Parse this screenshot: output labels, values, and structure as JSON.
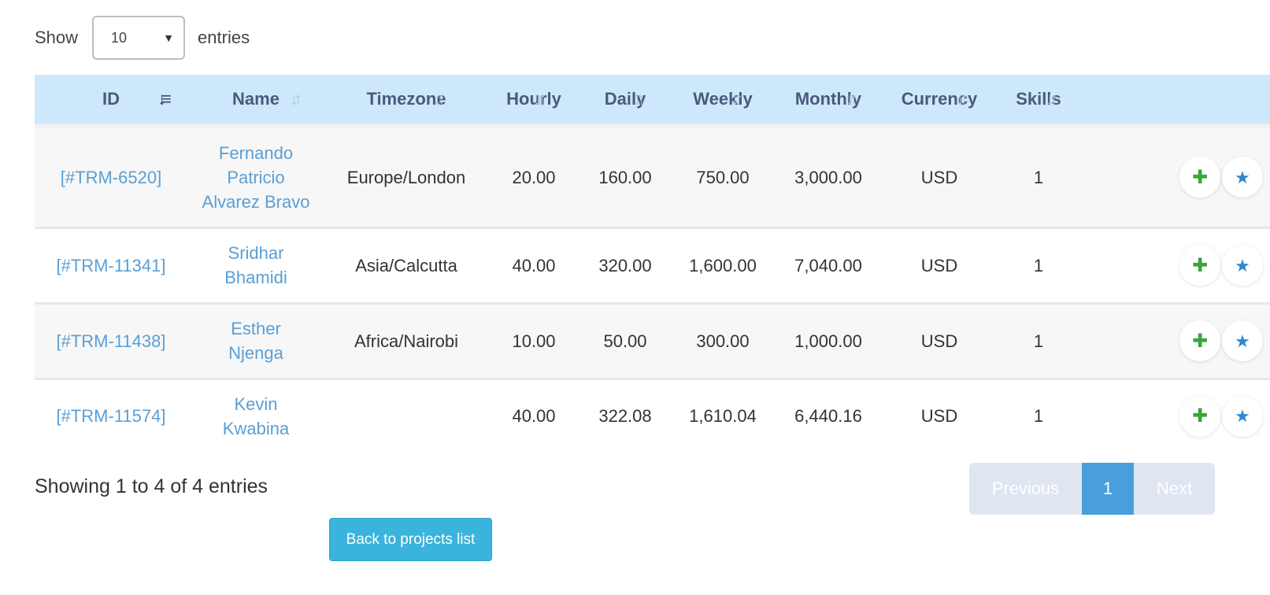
{
  "length": {
    "show_label": "Show",
    "value": "10",
    "entries_label": "entries"
  },
  "table": {
    "columns": [
      {
        "label": "ID",
        "sort": "desc"
      },
      {
        "label": "Name",
        "sort": "both"
      },
      {
        "label": "Timezone",
        "sort": "both"
      },
      {
        "label": "Hourly",
        "sort": "both"
      },
      {
        "label": "Daily",
        "sort": "both"
      },
      {
        "label": "Weekly",
        "sort": "both"
      },
      {
        "label": "Monthly",
        "sort": "both"
      },
      {
        "label": "Currency",
        "sort": "both"
      },
      {
        "label": "Skills",
        "sort": "both"
      }
    ],
    "rows": [
      {
        "id": "[#TRM-6520]",
        "name": "Fernando Patricio Alvarez Bravo",
        "timezone": "Europe/London",
        "hourly": "20.00",
        "daily": "160.00",
        "weekly": "750.00",
        "monthly": "3,000.00",
        "currency": "USD",
        "skills": "1"
      },
      {
        "id": "[#TRM-11341]",
        "name": "Sridhar Bhamidi",
        "timezone": "Asia/Calcutta",
        "hourly": "40.00",
        "daily": "320.00",
        "weekly": "1,600.00",
        "monthly": "7,040.00",
        "currency": "USD",
        "skills": "1"
      },
      {
        "id": "[#TRM-11438]",
        "name": "Esther Njenga",
        "timezone": "Africa/Nairobi",
        "hourly": "10.00",
        "daily": "50.00",
        "weekly": "300.00",
        "monthly": "1,000.00",
        "currency": "USD",
        "skills": "1"
      },
      {
        "id": "[#TRM-11574]",
        "name": "Kevin Kwabina",
        "timezone": "",
        "hourly": "40.00",
        "daily": "322.08",
        "weekly": "1,610.04",
        "monthly": "6,440.16",
        "currency": "USD",
        "skills": "1"
      }
    ],
    "actions": {
      "add_icon": "plus-icon",
      "favorite_icon": "star-icon"
    }
  },
  "info": "Showing 1 to 4 of 4 entries",
  "pagination": {
    "previous": "Previous",
    "current": "1",
    "next": "Next"
  },
  "back_button": "Back to projects list",
  "colors": {
    "header_bg": "#cde8fb",
    "link": "#5a9fd4",
    "plus": "#3aa53a",
    "star": "#2f86cf",
    "button": "#3ab4dc",
    "page_active": "#4a9fdb"
  }
}
